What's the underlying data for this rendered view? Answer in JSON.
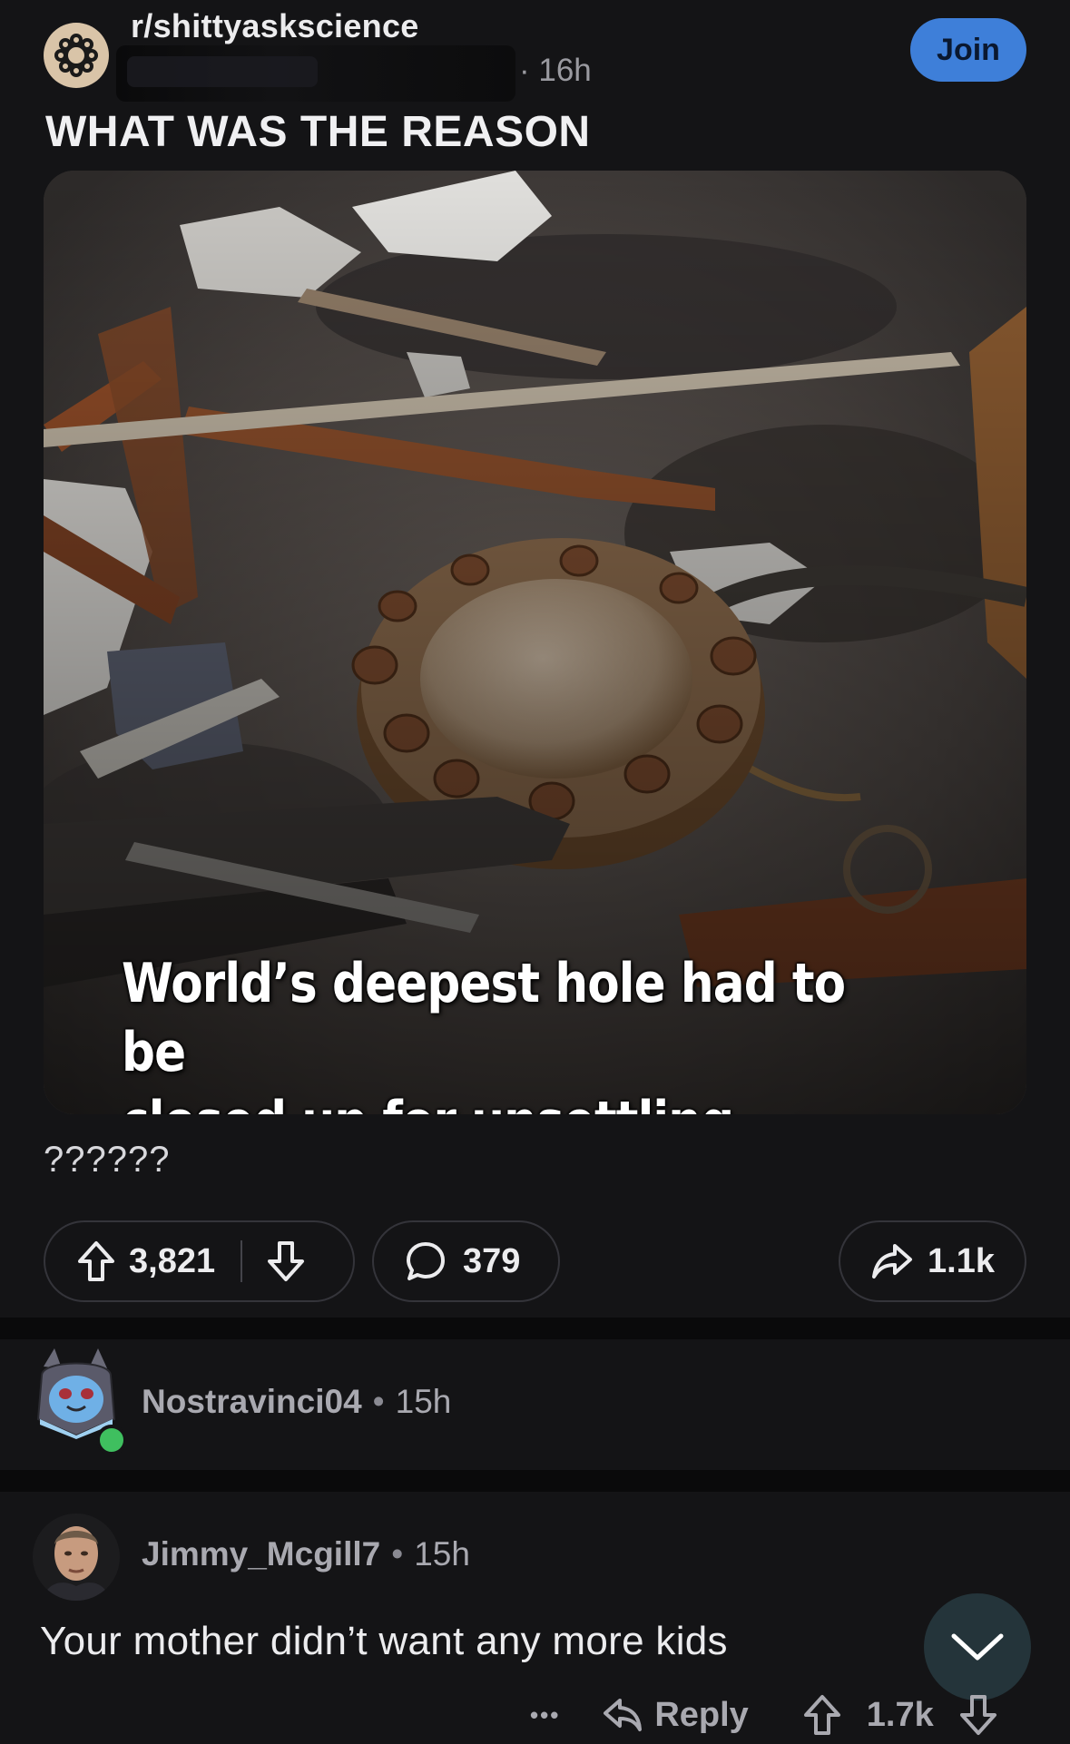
{
  "post": {
    "subreddit": "r/shittyaskscience",
    "age": "· 16h",
    "join_label": "Join",
    "title": "WHAT WAS THE REASON",
    "image_caption_line1": "World’s deepest hole had to be",
    "image_caption_line2": "closed up for unsettling reason",
    "body": "??????",
    "upvotes": "3,821",
    "comments": "379",
    "shares": "1.1k"
  },
  "comments": [
    {
      "username": "Nostravinci04",
      "separator": "•",
      "time": "15h"
    },
    {
      "username": "Jimmy_Mcgill7",
      "separator": "•",
      "time": "15h",
      "text": "Your mother didn’t want any more kids",
      "more_label": "•••",
      "reply_label": "Reply",
      "score": "1.7k"
    }
  ],
  "colors": {
    "background": "#141416",
    "join_button": "#3e7fd9",
    "online_badge": "#3fbf5f",
    "collapse_button": "#24343a"
  },
  "icons": [
    "subreddit-icon",
    "upvote-icon",
    "downvote-icon",
    "comment-icon",
    "share-icon",
    "reply-icon",
    "more-icon",
    "chevron-down-icon"
  ]
}
